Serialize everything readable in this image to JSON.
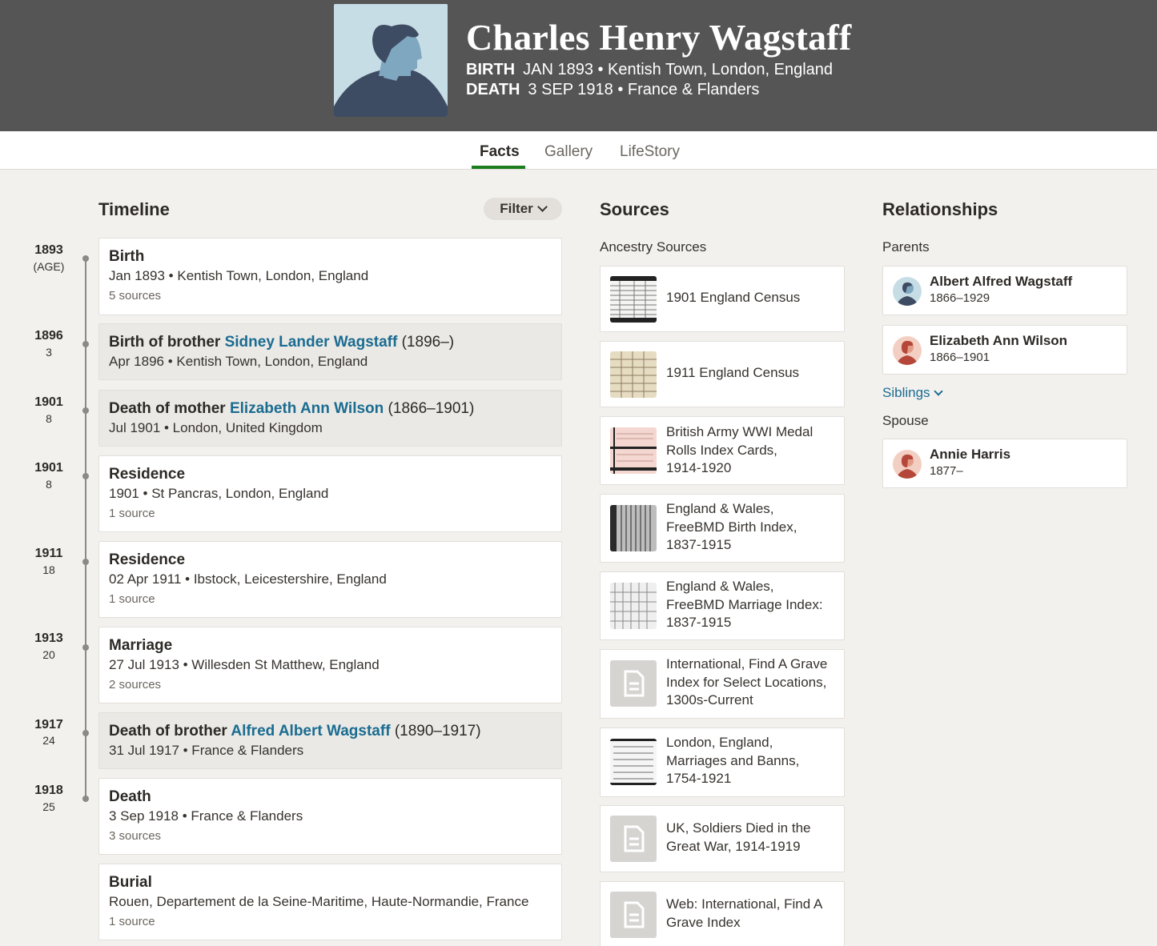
{
  "person": {
    "name": "Charles Henry Wagstaff",
    "birth_label": "BIRTH",
    "birth_value": "JAN 1893 • Kentish Town, London, England",
    "death_label": "DEATH",
    "death_value": "3 SEP 1918 • France & Flanders"
  },
  "tabs": [
    "Facts",
    "Gallery",
    "LifeStory"
  ],
  "timeline": {
    "heading": "Timeline",
    "filter_label": "Filter",
    "years": [
      {
        "year": "1893",
        "age": "(AGE)"
      },
      {
        "year": "1896",
        "age": "3"
      },
      {
        "year": "1901",
        "age": "8"
      },
      {
        "year": "1901",
        "age": "8"
      },
      {
        "year": "1911",
        "age": "18"
      },
      {
        "year": "1913",
        "age": "20"
      },
      {
        "year": "1917",
        "age": "24"
      },
      {
        "year": "1918",
        "age": "25"
      }
    ],
    "events": [
      {
        "title": "Birth",
        "detail": "Jan 1893 • Kentish Town, London, England",
        "sources": "5 sources"
      },
      {
        "title_prefix": "Birth of brother",
        "link": "Sidney Lander Wagstaff",
        "years": "(1896–)",
        "detail": "Apr 1896 • Kentish Town, London, England"
      },
      {
        "title_prefix": "Death of mother",
        "link": "Elizabeth Ann Wilson",
        "years": "(1866–1901)",
        "detail": "Jul 1901 • London, United Kingdom"
      },
      {
        "title": "Residence",
        "detail": "1901 • St Pancras, London, England",
        "sources": "1 source"
      },
      {
        "title": "Residence",
        "detail": "02 Apr 1911 • Ibstock, Leicestershire, England",
        "sources": "1 source"
      },
      {
        "title": "Marriage",
        "detail": "27 Jul 1913 • Willesden St Matthew, England",
        "sources": "2 sources"
      },
      {
        "title_prefix": "Death of brother",
        "link": "Alfred Albert Wagstaff",
        "years": "(1890–1917)",
        "detail": "31 Jul 1917 • France & Flanders"
      },
      {
        "title": "Death",
        "detail": "3 Sep 1918 • France & Flanders",
        "sources": "3 sources"
      },
      {
        "title": "Burial",
        "detail": "Rouen, Departement de la Seine-Maritime, Haute-Normandie, France",
        "sources": "1 source"
      }
    ]
  },
  "sources": {
    "heading": "Sources",
    "subheading": "Ancestry Sources",
    "items": [
      {
        "lines": [
          "1901 England Census"
        ],
        "thumb": "census-1901-image"
      },
      {
        "lines": [
          "1911 England Census"
        ],
        "thumb": "census-1911-image"
      },
      {
        "lines": [
          "British Army WWI Medal",
          "Rolls Index Cards,",
          "1914-1920"
        ],
        "thumb": "medal-card-image"
      },
      {
        "lines": [
          "England & Wales,",
          "FreeBMD Birth Index,",
          "1837-1915"
        ],
        "thumb": "birth-index-image"
      },
      {
        "lines": [
          "England & Wales,",
          "FreeBMD Marriage Index:",
          "1837-1915"
        ],
        "thumb": "marriage-index-image"
      },
      {
        "lines": [
          "International, Find A Grave",
          "Index for Select Locations,",
          "1300s-Current"
        ],
        "thumb": "document-icon"
      },
      {
        "lines": [
          "London, England,",
          "Marriages and Banns,",
          "1754-1921"
        ],
        "thumb": "banns-image"
      },
      {
        "lines": [
          "UK, Soldiers Died in the",
          "Great War, 1914-1919"
        ],
        "thumb": "document-icon"
      },
      {
        "lines": [
          "Web: International, Find A",
          "Grave Index"
        ],
        "thumb": "document-icon"
      }
    ]
  },
  "relationships": {
    "heading": "Relationships",
    "parents_label": "Parents",
    "parents": [
      {
        "name": "Albert Alfred Wagstaff",
        "years": "1866–1929",
        "gender": "male"
      },
      {
        "name": "Elizabeth Ann Wilson",
        "years": "1866–1901",
        "gender": "female"
      }
    ],
    "siblings_label": "Siblings",
    "spouse_label": "Spouse",
    "spouse": {
      "name": "Annie Harris",
      "years": "1877–",
      "gender": "female"
    }
  },
  "colors": {
    "header_bg": "#555555",
    "link": "#1a6c91",
    "tab_accent": "#1c7d1f",
    "page_bg": "#f3f1ee"
  }
}
